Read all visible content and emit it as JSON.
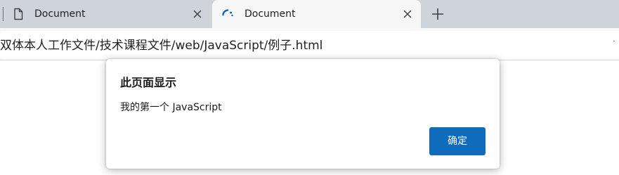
{
  "tabs": [
    {
      "title": "Document",
      "icon": "document-icon",
      "active": false
    },
    {
      "title": "Document",
      "icon": "loading-spinner-icon",
      "active": true
    }
  ],
  "address_bar": {
    "url": "双体本人工作文件/技术课程文件/web/JavaScript/例子.html"
  },
  "alert_dialog": {
    "title": "此页面显示",
    "message": "我的第一个 JavaScript",
    "ok_label": "确定"
  },
  "colors": {
    "tab_strip": "#cfd4db",
    "active_tab": "#f7f7f7",
    "accent_button": "#0f6cbd",
    "spinner": "#0f6cbd"
  }
}
